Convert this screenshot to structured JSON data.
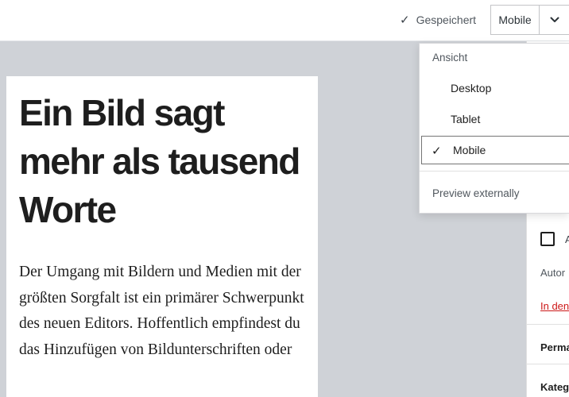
{
  "header": {
    "saved_label": "Gespeichert",
    "preview_label": "Mobile"
  },
  "editor": {
    "title": "Ein Bild sagt mehr als tausend Worte",
    "body": "Der Umgang mit Bildern und Medien mit der größten Sorgfalt ist ein primärer Schwerpunkt des neuen Editors. Hoffentlich empfindest du das Hinzufügen von Bildunterschriften oder"
  },
  "sidebar": {
    "checkbox_label": "A",
    "author_label": "Autor",
    "trash_link": "In den",
    "permalink_label": "Perma",
    "categories_label": "Kateg"
  },
  "preview_menu": {
    "heading": "Ansicht",
    "options": [
      {
        "label": "Desktop",
        "selected": false
      },
      {
        "label": "Tablet",
        "selected": false
      },
      {
        "label": "Mobile",
        "selected": true
      }
    ],
    "external_label": "Preview externally"
  },
  "colors": {
    "canvas_background": "#cfd2d7",
    "trash_link": "#cc1818",
    "text": "#1e1e1e"
  }
}
